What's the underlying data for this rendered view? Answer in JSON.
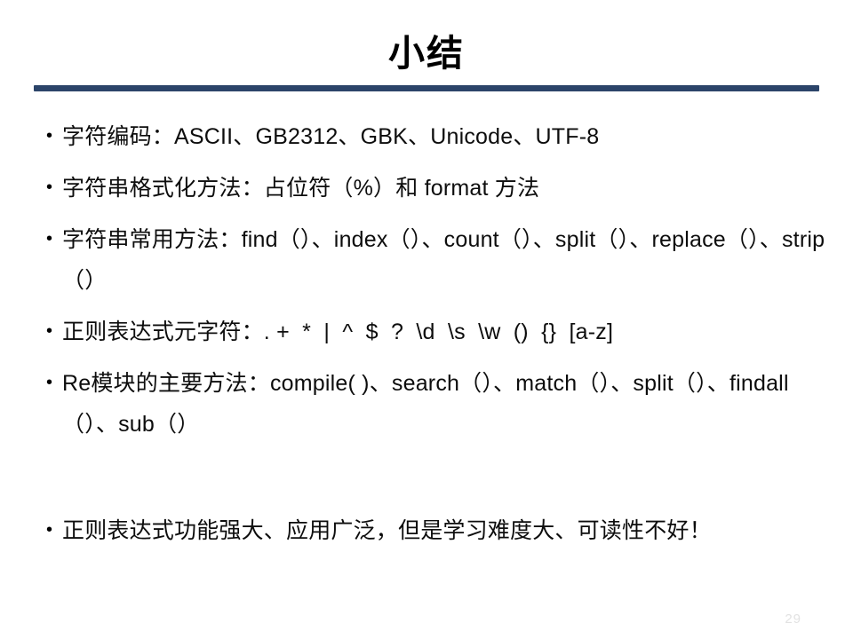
{
  "slide": {
    "title": "小结",
    "bullets": [
      {
        "text": "字符编码：ASCII、GB2312、GBK、Unicode、UTF-8"
      },
      {
        "text": "字符串格式化方法：占位符（%）和 format 方法"
      },
      {
        "text": "字符串常用方法：find（）、index（）、count（）、split（）、replace（）、strip（）"
      },
      {
        "text": "正则表达式元字符：. +  *  |  ^  $  ?  \\d  \\s  \\w  ()  {}  [a-z]"
      },
      {
        "text": "Re模块的主要方法：compile( )、search（）、match（）、split（）、findall（）、sub（）"
      },
      {
        "text": "正则表达式功能强大、应用广泛，但是学习难度大、可读性不好！"
      }
    ],
    "page_number": "29",
    "colors": {
      "rule": "#2b4469",
      "text": "#0d0d0d",
      "background": "#ffffff",
      "page_number": "#e2e2e2"
    }
  }
}
